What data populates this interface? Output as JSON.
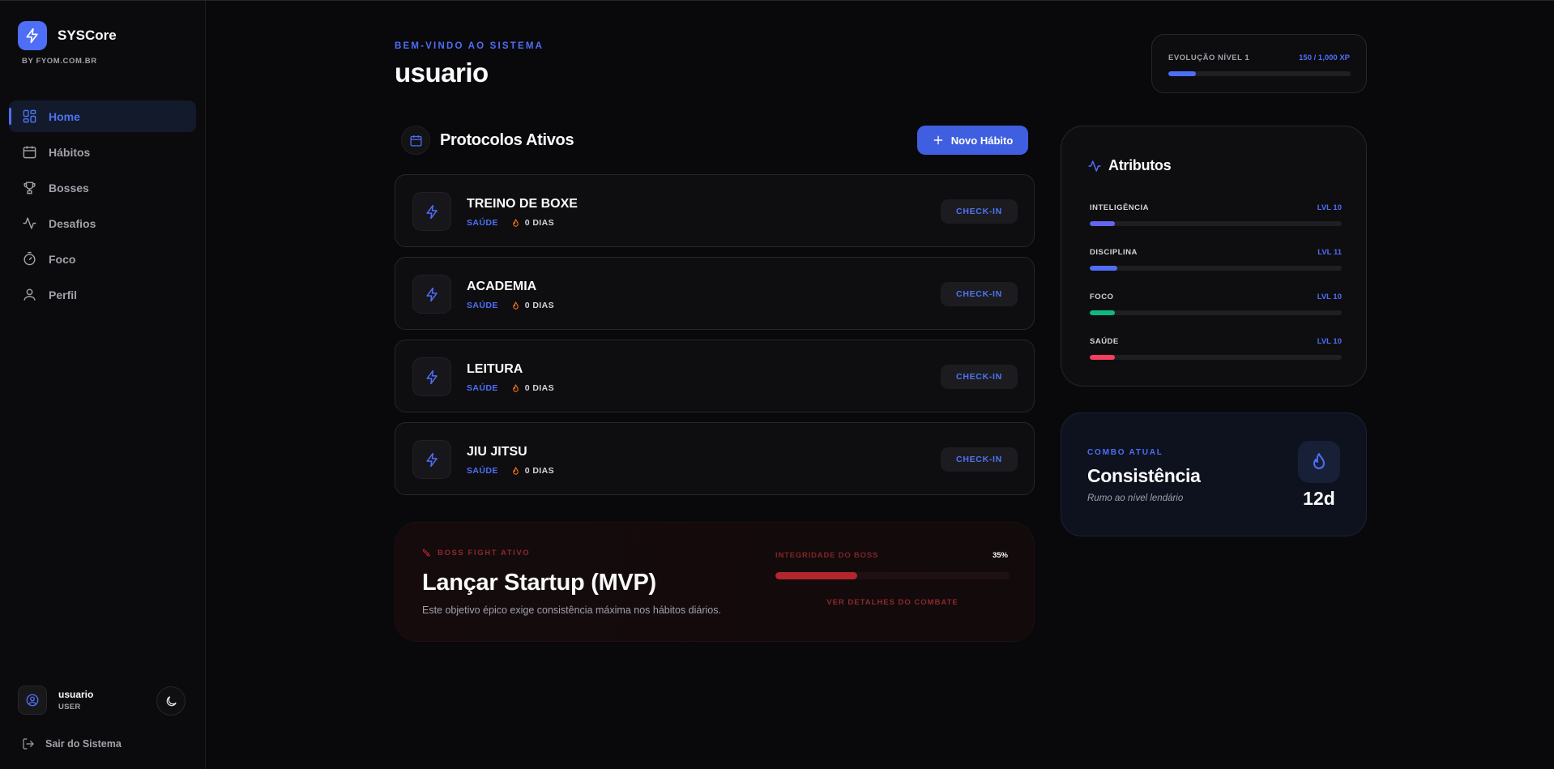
{
  "brand": {
    "name": "SYSCore",
    "subtitle": "BY FYOM.COM.BR"
  },
  "nav": [
    {
      "label": "Home",
      "icon": "grid-icon",
      "active": true
    },
    {
      "label": "Hábitos",
      "icon": "calendar-icon",
      "active": false
    },
    {
      "label": "Bosses",
      "icon": "trophy-icon",
      "active": false
    },
    {
      "label": "Desafios",
      "icon": "activity-icon",
      "active": false
    },
    {
      "label": "Foco",
      "icon": "timer-icon",
      "active": false
    },
    {
      "label": "Perfil",
      "icon": "user-icon",
      "active": false
    }
  ],
  "user": {
    "name": "usuario",
    "role": "USER"
  },
  "logout_label": "Sair do Sistema",
  "header": {
    "welcome": "BEM-VINDO AO SISTEMA",
    "username": "usuario"
  },
  "xp": {
    "label": "EVOLUÇÃO NÍVEL 1",
    "value_text": "150 / 1,000 XP",
    "progress": 0.15
  },
  "protocols": {
    "title": "Protocolos Ativos",
    "new_button": "Novo Hábito",
    "checkin_label": "CHECK-IN",
    "habits": [
      {
        "name": "TREINO DE BOXE",
        "category": "SAÚDE",
        "streak": "0 DIAS"
      },
      {
        "name": "ACADEMIA",
        "category": "SAÚDE",
        "streak": "0 DIAS"
      },
      {
        "name": "LEITURA",
        "category": "SAÚDE",
        "streak": "0 DIAS"
      },
      {
        "name": "JIU JITSU",
        "category": "SAÚDE",
        "streak": "0 DIAS"
      }
    ]
  },
  "boss": {
    "tag": "BOSS FIGHT ATIVO",
    "title": "Lançar Startup (MVP)",
    "description": "Este objetivo épico exige consistência máxima nos hábitos diários.",
    "integrity_label": "INTEGRIDADE DO BOSS",
    "integrity_value": "35%",
    "integrity": 0.35,
    "link": "VER DETALHES DO COMBATE"
  },
  "attributes": {
    "title": "Atributos",
    "items": [
      {
        "name": "INTELIGÊNCIA",
        "level": "LVL 10",
        "progress": 0.1,
        "color": "#6366f1"
      },
      {
        "name": "DISCIPLINA",
        "level": "LVL 11",
        "progress": 0.11,
        "color": "#4f6ef7"
      },
      {
        "name": "FOCO",
        "level": "LVL 10",
        "progress": 0.1,
        "color": "#10b981"
      },
      {
        "name": "SAÚDE",
        "level": "LVL 10",
        "progress": 0.1,
        "color": "#f43f5e"
      }
    ]
  },
  "combo": {
    "label": "COMBO ATUAL",
    "title": "Consistência",
    "subtitle": "Rumo ao nível lendário",
    "days": "12d"
  },
  "colors": {
    "accent": "#4f6ef7",
    "background": "#09090b",
    "danger": "#b3262d",
    "flame": "#f97316"
  }
}
